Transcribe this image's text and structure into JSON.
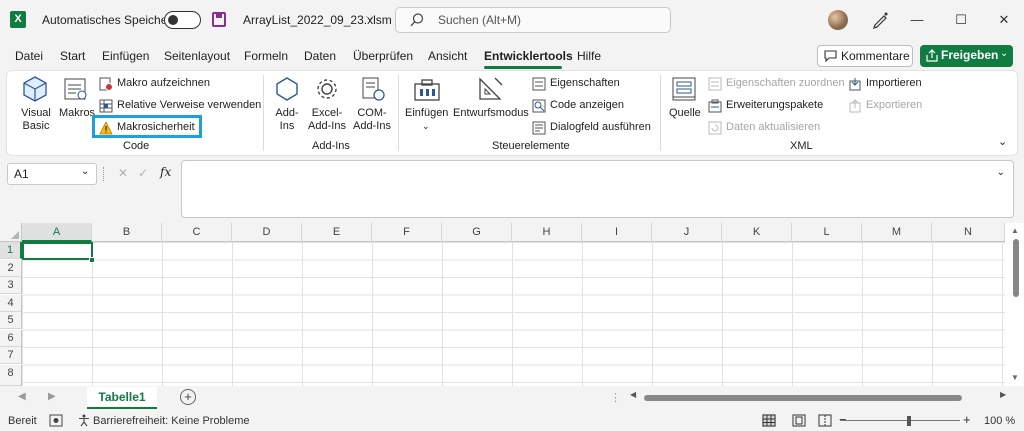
{
  "app_icon": "X",
  "title": {
    "autosave_label": "Automatisches Speichern",
    "filename": "ArrayList_2022_09_23.xlsm",
    "search_placeholder": "Suchen (Alt+M)"
  },
  "tabs": [
    "Datei",
    "Start",
    "Einfügen",
    "Seitenlayout",
    "Formeln",
    "Daten",
    "Überprüfen",
    "Ansicht",
    "Entwicklertools",
    "Hilfe"
  ],
  "active_tab": "Entwicklertools",
  "actions": {
    "comments": "Kommentare",
    "share": "Freigeben"
  },
  "ribbon": {
    "code": {
      "label": "Code",
      "visual_basic": [
        "Visual",
        "Basic"
      ],
      "macros": "Makros",
      "record_macro": "Makro aufzeichnen",
      "relative_refs": "Relative Verweise verwenden",
      "macro_security": "Makrosicherheit"
    },
    "addins": {
      "label": "Add-Ins",
      "addins": [
        "Add-",
        "Ins"
      ],
      "excel_addins": [
        "Excel-",
        "Add-Ins"
      ],
      "com_addins": [
        "COM-",
        "Add-Ins"
      ]
    },
    "controls": {
      "label": "Steuerelemente",
      "insert": "Einfügen",
      "design_mode": "Entwurfsmodus",
      "properties": "Eigenschaften",
      "view_code": "Code anzeigen",
      "run_dialog": "Dialogfeld ausführen"
    },
    "xml": {
      "label": "XML",
      "source": "Quelle",
      "map_properties": "Eigenschaften zuordnen",
      "expansion_packs": "Erweiterungspakete",
      "refresh_data": "Daten aktualisieren",
      "import": "Importieren",
      "export": "Exportieren"
    }
  },
  "formula_bar": {
    "name_box": "A1",
    "fx": "fx",
    "cancel": "✕",
    "enter": "✓"
  },
  "grid": {
    "columns": [
      "A",
      "B",
      "C",
      "D",
      "E",
      "F",
      "G",
      "H",
      "I",
      "J",
      "K",
      "L",
      "M",
      "N"
    ],
    "rows": [
      "1",
      "2",
      "3",
      "4",
      "5",
      "6",
      "7",
      "8"
    ],
    "selected_cell": "A1"
  },
  "sheets": {
    "active": "Tabelle1",
    "add_label": "+"
  },
  "status": {
    "ready": "Bereit",
    "accessibility": "Barrierefreiheit: Keine Probleme",
    "zoom_minus": "−",
    "zoom_plus": "+",
    "zoom": "100 %"
  },
  "colors": {
    "excel_green": "#107c41",
    "highlight": "#1da1dc",
    "disabled": "#a5a5a5"
  }
}
